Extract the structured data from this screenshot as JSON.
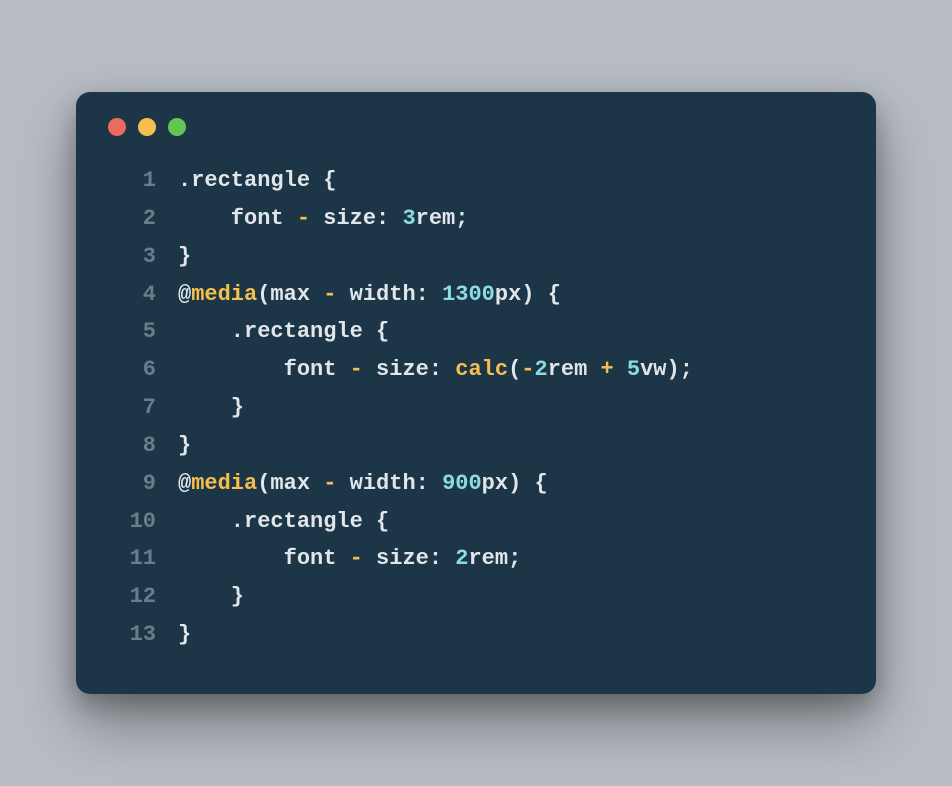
{
  "code": {
    "lines": [
      {
        "num": "1",
        "tokens": [
          {
            "cls": "selector",
            "t": ".rectangle "
          },
          {
            "cls": "brace",
            "t": "{"
          }
        ]
      },
      {
        "num": "2",
        "tokens": [
          {
            "cls": "base",
            "t": "    font "
          },
          {
            "cls": "op",
            "t": "-"
          },
          {
            "cls": "base",
            "t": " size: "
          },
          {
            "cls": "number",
            "t": "3"
          },
          {
            "cls": "base",
            "t": "rem;"
          }
        ]
      },
      {
        "num": "3",
        "tokens": [
          {
            "cls": "brace",
            "t": "}"
          }
        ]
      },
      {
        "num": "4",
        "tokens": [
          {
            "cls": "base",
            "t": "@"
          },
          {
            "cls": "keyword",
            "t": "media"
          },
          {
            "cls": "base",
            "t": "(max "
          },
          {
            "cls": "op",
            "t": "-"
          },
          {
            "cls": "base",
            "t": " width: "
          },
          {
            "cls": "number",
            "t": "1300"
          },
          {
            "cls": "base",
            "t": "px) "
          },
          {
            "cls": "brace",
            "t": "{"
          }
        ]
      },
      {
        "num": "5",
        "tokens": [
          {
            "cls": "selector",
            "t": "    .rectangle "
          },
          {
            "cls": "brace",
            "t": "{"
          }
        ]
      },
      {
        "num": "6",
        "tokens": [
          {
            "cls": "base",
            "t": "        font "
          },
          {
            "cls": "op",
            "t": "-"
          },
          {
            "cls": "base",
            "t": " size: "
          },
          {
            "cls": "func",
            "t": "calc"
          },
          {
            "cls": "base",
            "t": "("
          },
          {
            "cls": "op",
            "t": "-"
          },
          {
            "cls": "number",
            "t": "2"
          },
          {
            "cls": "base",
            "t": "rem "
          },
          {
            "cls": "op",
            "t": "+"
          },
          {
            "cls": "base",
            "t": " "
          },
          {
            "cls": "number",
            "t": "5"
          },
          {
            "cls": "base",
            "t": "vw);"
          }
        ]
      },
      {
        "num": "7",
        "tokens": [
          {
            "cls": "brace",
            "t": "    }"
          }
        ]
      },
      {
        "num": "8",
        "tokens": [
          {
            "cls": "brace",
            "t": "}"
          }
        ]
      },
      {
        "num": "9",
        "tokens": [
          {
            "cls": "base",
            "t": "@"
          },
          {
            "cls": "keyword",
            "t": "media"
          },
          {
            "cls": "base",
            "t": "(max "
          },
          {
            "cls": "op",
            "t": "-"
          },
          {
            "cls": "base",
            "t": " width: "
          },
          {
            "cls": "number",
            "t": "900"
          },
          {
            "cls": "base",
            "t": "px) "
          },
          {
            "cls": "brace",
            "t": "{"
          }
        ]
      },
      {
        "num": "10",
        "tokens": [
          {
            "cls": "selector",
            "t": "    .rectangle "
          },
          {
            "cls": "brace",
            "t": "{"
          }
        ]
      },
      {
        "num": "11",
        "tokens": [
          {
            "cls": "base",
            "t": "        font "
          },
          {
            "cls": "op",
            "t": "-"
          },
          {
            "cls": "base",
            "t": " size: "
          },
          {
            "cls": "number",
            "t": "2"
          },
          {
            "cls": "base",
            "t": "rem;"
          }
        ]
      },
      {
        "num": "12",
        "tokens": [
          {
            "cls": "brace",
            "t": "    }"
          }
        ]
      },
      {
        "num": "13",
        "tokens": [
          {
            "cls": "brace",
            "t": "}"
          }
        ]
      }
    ]
  }
}
